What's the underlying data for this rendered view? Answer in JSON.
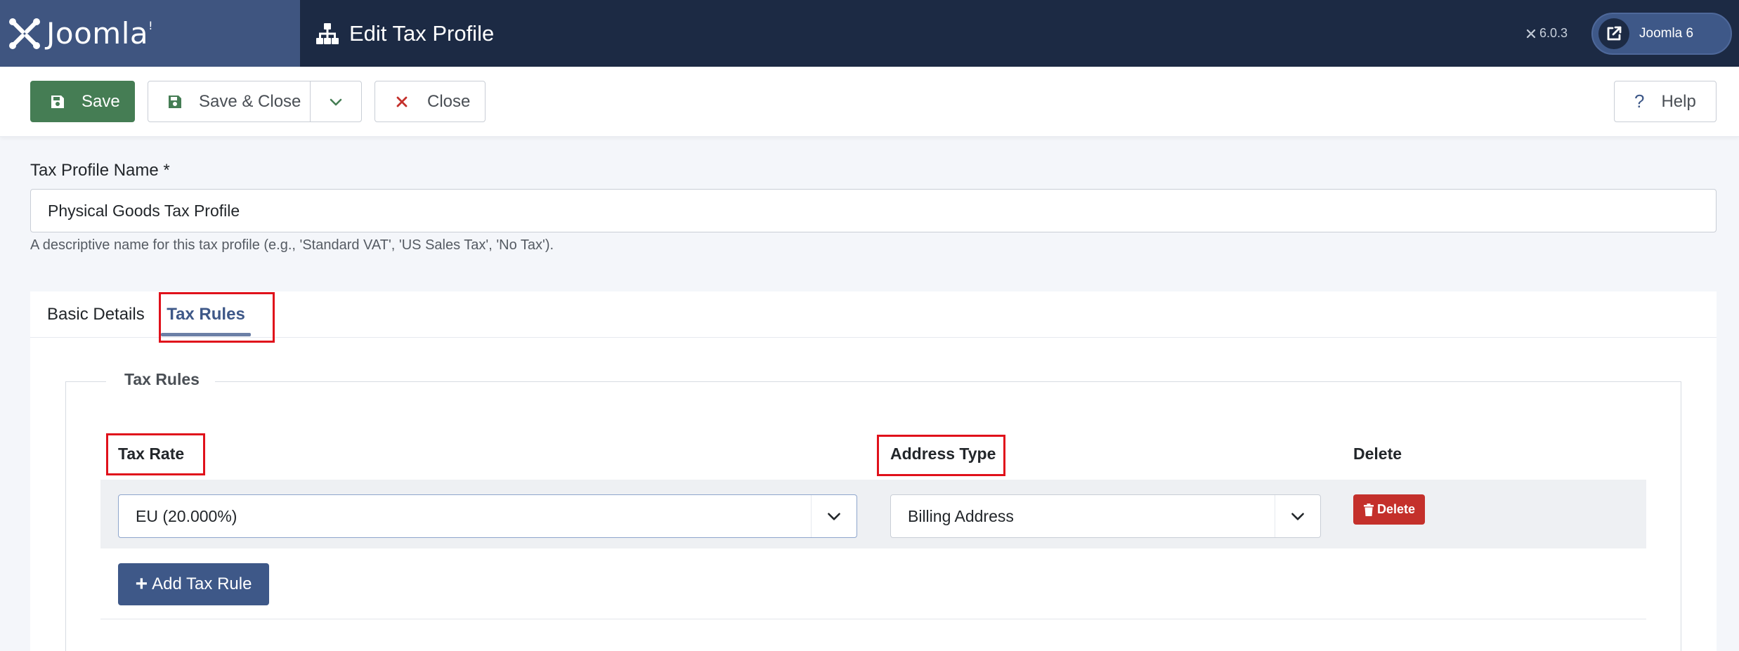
{
  "header": {
    "brand": "Joomla!",
    "brand_word": "Joomla",
    "brand_mark": "!",
    "page_title": "Edit Tax Profile",
    "version": "6.0.3",
    "site_button": "Joomla 6"
  },
  "toolbar": {
    "save_label": "Save",
    "save_close_label": "Save & Close",
    "close_label": "Close",
    "help_label": "Help",
    "help_glyph": "?"
  },
  "form": {
    "name_label": "Tax Profile Name *",
    "name_value": "Physical Goods Tax Profile",
    "name_hint": "A descriptive name for this tax profile (e.g., 'Standard VAT', 'US Sales Tax', 'No Tax')."
  },
  "tabs": [
    {
      "label": "Basic Details",
      "active": false
    },
    {
      "label": "Tax Rules",
      "active": true
    }
  ],
  "tax_rules": {
    "legend": "Tax Rules",
    "columns": [
      "Tax Rate",
      "Address Type",
      "Delete"
    ],
    "rows": [
      {
        "tax_rate": "EU (20.000%)",
        "address_type": "Billing Address",
        "delete_label": "Delete"
      }
    ],
    "add_label": "Add Tax Rule",
    "add_glyph": "+"
  },
  "colors": {
    "header_bg": "#1c2a44",
    "brand_bg": "#3f5580",
    "save_green": "#457d54",
    "accent_blue": "#3e5888",
    "danger_red": "#c4302b",
    "annotation_red": "#e0111b"
  }
}
